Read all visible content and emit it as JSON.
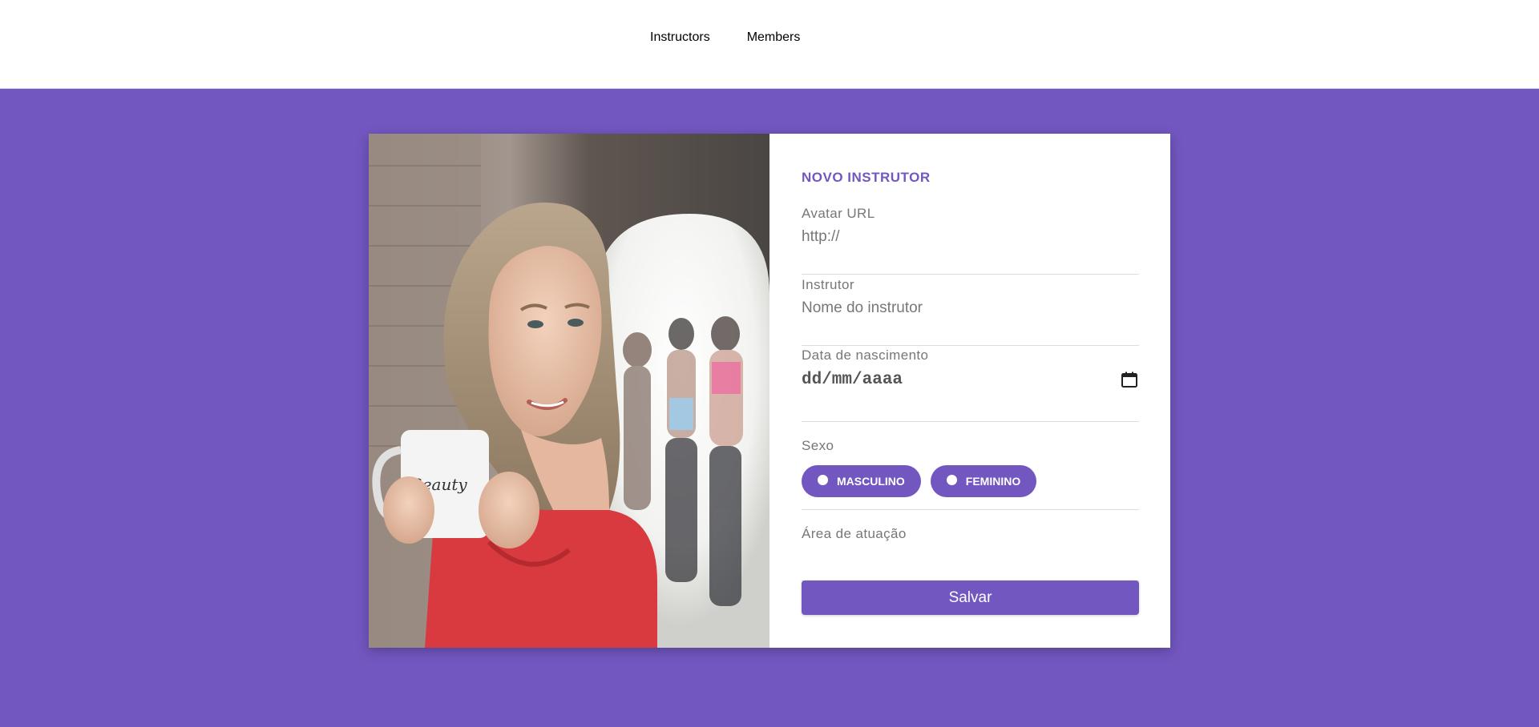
{
  "nav": {
    "items": [
      {
        "label": "Instructors",
        "active": true
      },
      {
        "label": "Members",
        "active": false
      }
    ]
  },
  "form": {
    "title": "NOVO INSTRUTOR",
    "avatar": {
      "label": "Avatar URL",
      "placeholder": "http://"
    },
    "instrutor": {
      "label": "Instrutor",
      "placeholder": "Nome do instrutor"
    },
    "nascimento": {
      "label": "Data de nascimento",
      "value": "dd/mm/aaaa"
    },
    "sexo": {
      "label": "Sexo",
      "options": [
        "MASCULINO",
        "FEMININO"
      ]
    },
    "area": {
      "label": "Área de atuação",
      "value": ""
    },
    "save_label": "Salvar"
  },
  "colors": {
    "accent": "#7257c0",
    "background": "#7257c0",
    "card": "#ffffff",
    "text_muted": "#777777"
  },
  "icons": {
    "calendar": "calendar-icon"
  }
}
